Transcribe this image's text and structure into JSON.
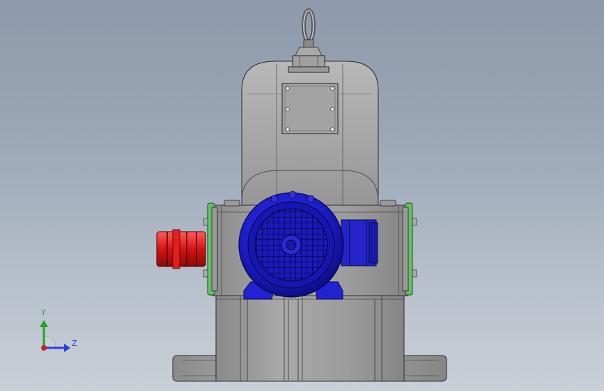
{
  "triad": {
    "y_label": "Y",
    "z_label": "Z",
    "y_color": "#1fa51f",
    "z_color": "#2a3fd6",
    "x_color": "#d21d1d"
  },
  "colors": {
    "housing": "#9b9b9b",
    "motor": "#1f1fd0",
    "motor_dark": "#0f0f7a",
    "coupling": "#d21414",
    "flange": "#5bb55b"
  }
}
